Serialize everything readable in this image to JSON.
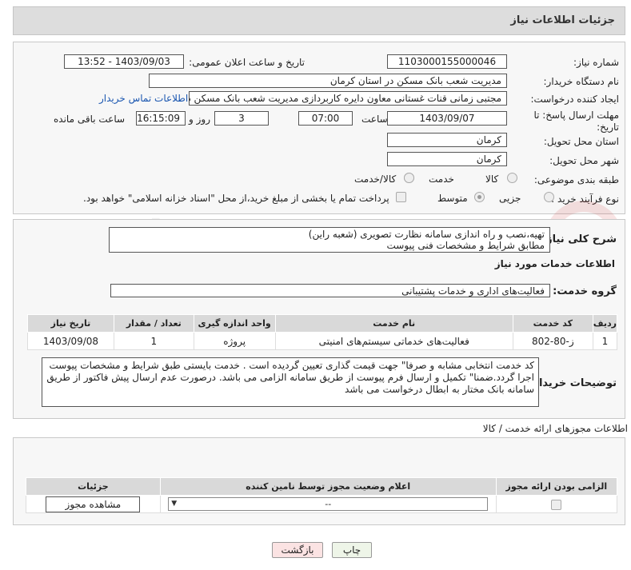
{
  "header": {
    "title": "جزئیات اطلاعات نیاز"
  },
  "fields": {
    "need_number_label": "شماره نیاز:",
    "need_number": "1103000155000046",
    "announce_label": "تاریخ و ساعت اعلان عمومی:",
    "announce_value": "1403/09/03 - 13:52",
    "buyer_label": "نام دستگاه خریدار:",
    "buyer_value": "مدیریت شعب بانک مسکن در استان کرمان",
    "creator_label": "ایجاد کننده درخواست:",
    "creator_value": "مجتبی زمانی قنات غستانی معاون دایره کاربردازی مدیریت شعب بانک مسکن د",
    "contact_link": "اطلاعات تماس خریدار",
    "deadline_label": "مهلت ارسال پاسخ: تا تاریخ:",
    "deadline_date": "1403/09/07",
    "time_label": "ساعت",
    "deadline_time": "07:00",
    "days_value": "3",
    "days_label": "روز و",
    "remaining_time": "16:15:09",
    "remaining_label": "ساعت باقی مانده",
    "province_label": "استان محل تحویل:",
    "province_value": "کرمان",
    "city_label": "شهر محل تحویل:",
    "city_value": "کرمان",
    "category_label": "طبقه بندی موضوعی:",
    "category_options": [
      "کالا",
      "خدمت",
      "کالا/خدمت"
    ],
    "process_label": "نوع فرآیند خرید :",
    "process_options": [
      "جزیی",
      "متوسط"
    ],
    "payment_note": "پرداخت تمام یا بخشی از مبلغ خرید،از محل \"اسناد خزانه اسلامی\" خواهد بود."
  },
  "description": {
    "label": "شرح کلی نیاز:",
    "line1": "تهیه،نصب و راه اندازی سامانه نظارت تصویری (شعبه راین)",
    "line2": "مطابق شرایط و  مشخصات فنی پیوست"
  },
  "services": {
    "section_title": "اطلاعات خدمات مورد نیاز",
    "group_label": "گروه خدمت:",
    "group_value": "فعالیت‌های اداری و خدمات پشتیبانی",
    "columns": [
      "ردیف",
      "کد خدمت",
      "نام خدمت",
      "واحد اندازه گیری",
      "تعداد / مقدار",
      "تاریخ نیاز"
    ],
    "rows": [
      [
        "1",
        "ز-80-802",
        "فعالیت‌های خدماتی سیستم‌های امنیتی",
        "پروژه",
        "1",
        "1403/09/08"
      ]
    ]
  },
  "buyer_notes": {
    "label": "توضیحات خریدار:",
    "text": "کد خدمت انتخابی مشابه و صرفا\" جهت قیمت گذاری تعیین گردیده است . خدمت بایستی طبق شرایط و مشخصات پیوست اجرا گردد.ضمنا\" تکمیل و ارسال فرم پیوست از طریق سامانه الزامی می باشد. درصورت عدم ارسال پیش فاکتور از طریق سامانه بانک مختار به ابطال درخواست می باشد"
  },
  "permits": {
    "section_title": "اطلاعات مجوزهای ارائه خدمت / کالا",
    "columns": [
      "الزامی بودن ارائه مجوز",
      "اعلام وضعیت مجوز توسط نامین کننده",
      "جزئیات"
    ],
    "select_value": "--",
    "view_button": "مشاهده مجوز"
  },
  "buttons": {
    "print": "چاپ",
    "back": "بازگشت"
  },
  "watermark": "AriaTender.neT"
}
